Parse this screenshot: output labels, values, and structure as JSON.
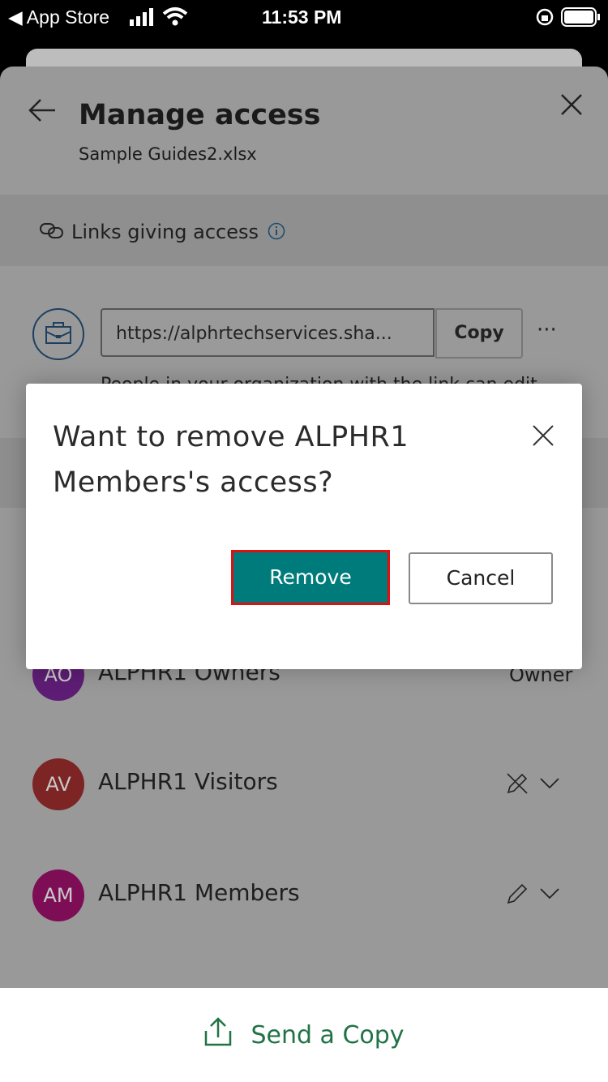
{
  "status_bar": {
    "back_label": "◀ App Store",
    "time": "11:53 PM"
  },
  "header": {
    "title": "Manage access",
    "file_name": "Sample Guides2.xlsx"
  },
  "links_section": {
    "label": "Links giving access"
  },
  "link": {
    "url": "https://alphrtechservices.sha...",
    "copy_label": "Copy",
    "description": "People in your organization with the link can edit"
  },
  "people": [
    {
      "initials": "AO",
      "name": "ALPHR1 Owners",
      "role": "Owner",
      "color": "#5e1d75"
    },
    {
      "initials": "AV",
      "name": "ALPHR1 Visitors",
      "permission_icon": "pencil-off-icon",
      "color": "#7d2424"
    },
    {
      "initials": "AM",
      "name": "ALPHR1 Members",
      "permission_icon": "pencil-icon",
      "color": "#7d0e56"
    }
  ],
  "dialog": {
    "title": "Want to remove ALPHR1 Members's access?",
    "remove_label": "Remove",
    "cancel_label": "Cancel",
    "accent": "#007b7b",
    "highlight": "#e01010"
  },
  "footer": {
    "send_copy_label": "Send a Copy",
    "color": "#217346"
  }
}
